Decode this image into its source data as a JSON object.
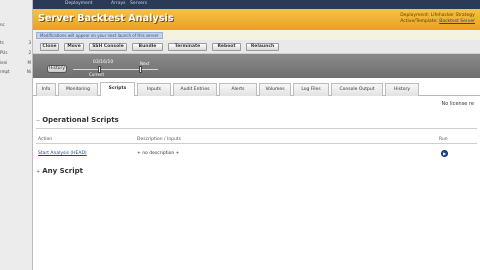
{
  "sidebar": {
    "items": [
      {
        "label": "nc",
        "value": ""
      },
      {
        "label": "ts",
        "value": "3"
      },
      {
        "label": "PUs",
        "value": "2"
      },
      {
        "label": "ieni",
        "value": "M"
      },
      {
        "label": "rmpt",
        "value": "Ni"
      }
    ]
  },
  "topnav": {
    "items": [
      "Deployment",
      "Arrays",
      "Servers"
    ]
  },
  "header": {
    "title": "Server Backtest Analysis",
    "subtitle": "",
    "account_line1": "Deployment: Lifehacker Strategy",
    "account_line2": "Active/Template:",
    "account_link": "Backtest Server"
  },
  "notice": {
    "text": "Modifications will appear on your next launch of this server"
  },
  "actions": {
    "buttons": [
      "Clone",
      "Move",
      "SSH Console",
      "Bundle",
      "Terminate",
      "Reboot",
      "Relaunch"
    ]
  },
  "timeline": {
    "history_label": "History",
    "date": "03/16/10",
    "current_label": "Current",
    "next_label": "Next"
  },
  "tabs": {
    "items": [
      "Info",
      "Monitoring",
      "Scripts",
      "Inputs",
      "Audit Entries",
      "Alerts",
      "Volumes",
      "Log Files",
      "Console Output",
      "History"
    ],
    "active": "Scripts"
  },
  "content": {
    "right_notice": "No license re",
    "operational": {
      "title": "Operational Scripts",
      "col_action": "Action",
      "col_description": "Description / Inputs",
      "col_run": "Run",
      "row_action": "Start Analysis (HEAD)",
      "row_description": "+ no description +"
    },
    "any_script": {
      "title": "Any Script"
    }
  },
  "colors": {
    "header_gold": "#e9a21e",
    "topnav": "#2b3a56",
    "link": "#1d3fa5"
  }
}
